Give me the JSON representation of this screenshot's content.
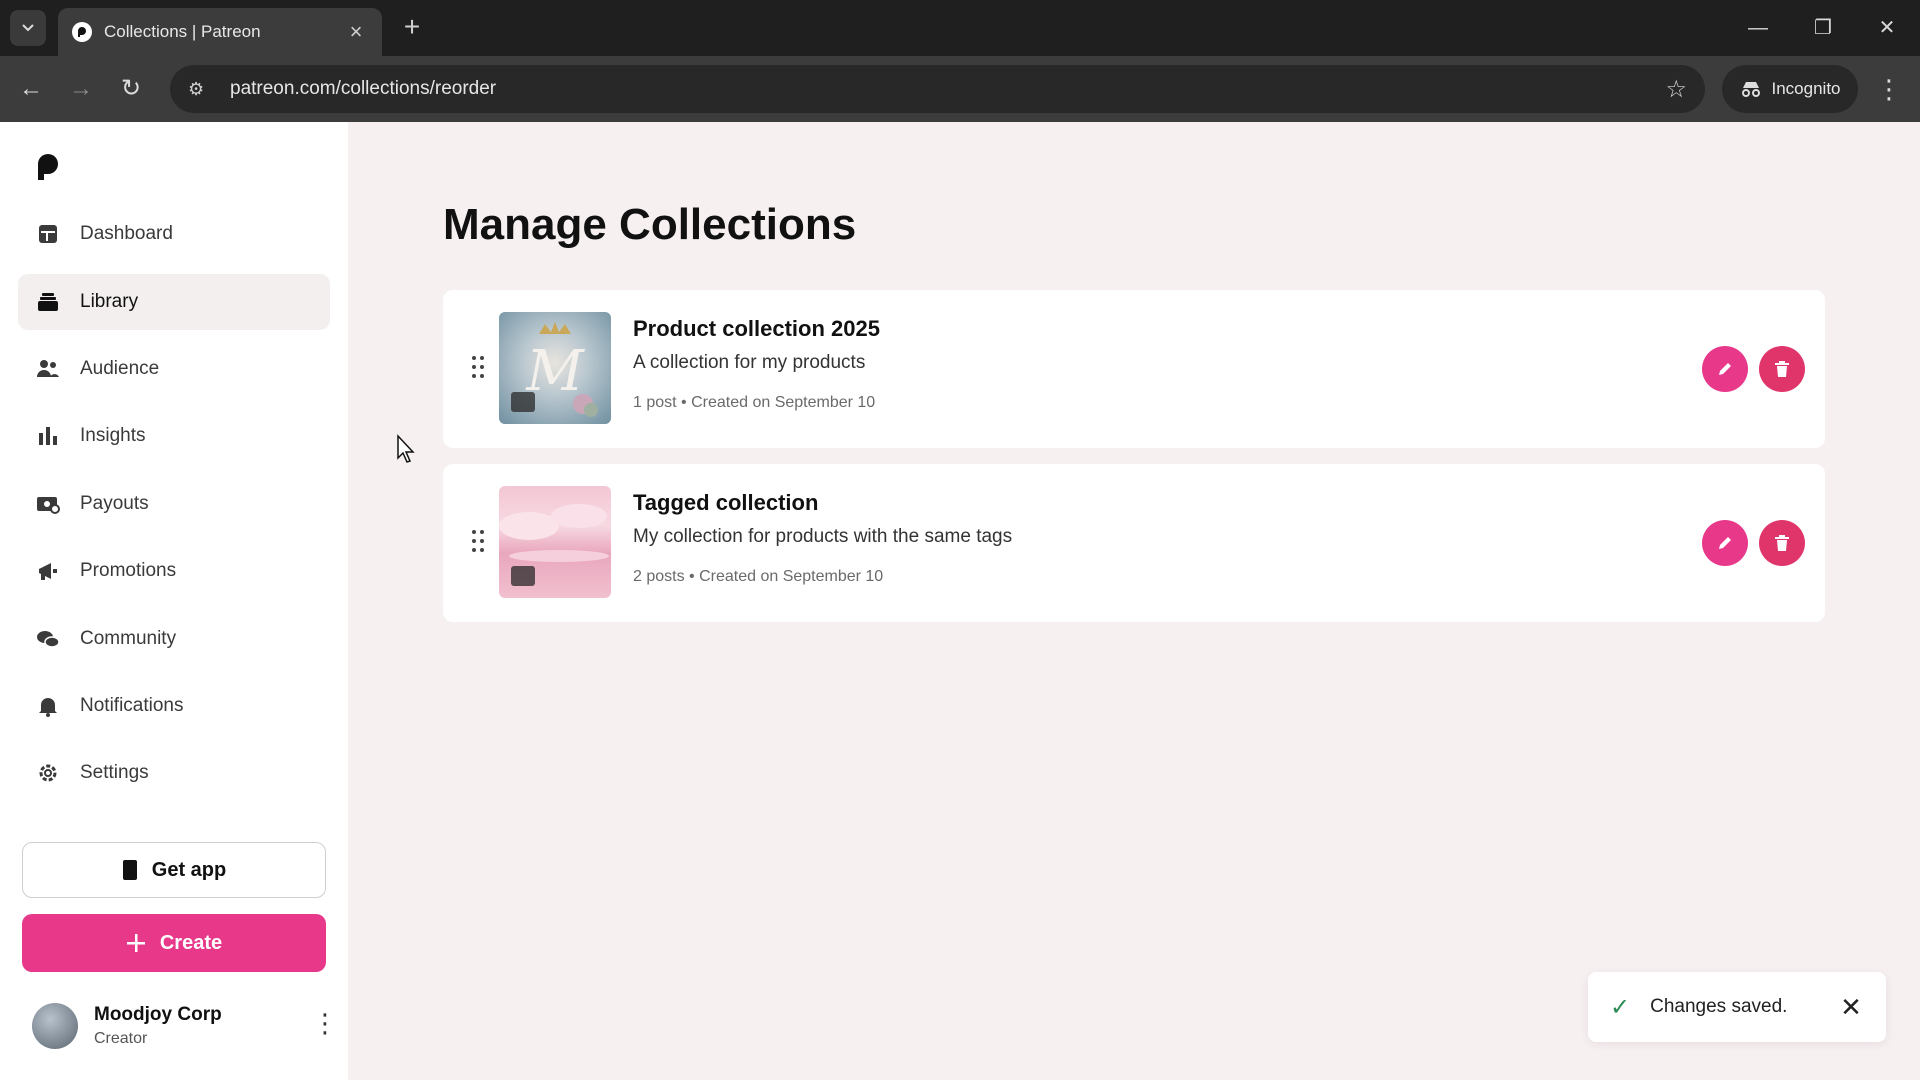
{
  "browser": {
    "tab_title": "Collections | Patreon",
    "url": "patreon.com/collections/reorder",
    "incognito_label": "Incognito"
  },
  "sidebar": {
    "items": [
      {
        "label": "Dashboard",
        "icon": "dashboard-icon"
      },
      {
        "label": "Library",
        "icon": "library-icon",
        "active": true
      },
      {
        "label": "Audience",
        "icon": "audience-icon"
      },
      {
        "label": "Insights",
        "icon": "insights-icon"
      },
      {
        "label": "Payouts",
        "icon": "payouts-icon"
      },
      {
        "label": "Promotions",
        "icon": "promotions-icon"
      },
      {
        "label": "Community",
        "icon": "community-icon"
      },
      {
        "label": "Notifications",
        "icon": "bell-icon"
      },
      {
        "label": "Settings",
        "icon": "gear-icon"
      }
    ],
    "get_app_label": "Get app",
    "create_label": "Create",
    "user": {
      "name": "Moodjoy Corp",
      "role": "Creator"
    }
  },
  "main": {
    "title": "Manage Collections",
    "collections": [
      {
        "title": "Product collection 2025",
        "description": "A collection for my products",
        "meta": "1 post • Created on September 10"
      },
      {
        "title": "Tagged collection",
        "description": "My collection for products with the same tags",
        "meta": "2 posts • Created on September 10"
      }
    ]
  },
  "toast": {
    "message": "Changes saved."
  },
  "colors": {
    "brand_pink": "#e8388a",
    "delete_red": "#e0356a",
    "success_green": "#2e8b57"
  }
}
